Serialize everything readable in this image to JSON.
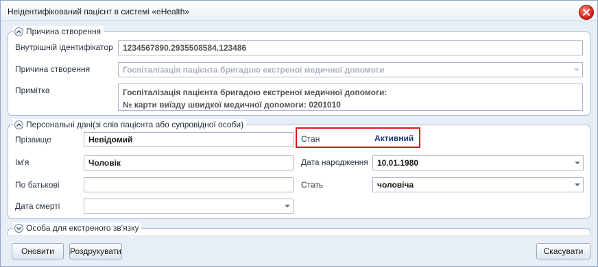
{
  "window": {
    "title": "Неідентифікований пацієнт в системі «eHealth»"
  },
  "creation_group": {
    "header": "Причина створення",
    "internal_id_label": "Внутрішній ідентифікатор",
    "internal_id_value": "1234567890.2935508584.123486",
    "reason_label": "Причина створення",
    "reason_value": "Госпіталізація пацієнта бригадою екстреної медичної допомоги",
    "note_label": "Примітка",
    "note_line1": "Госпіталізація пацієнта бригадою екстреної медичної допомоги:",
    "note_line2": "№ карти виїзду швидкої медичної допомоги: 0201010"
  },
  "personal_group": {
    "header": "Персональні дані(зі слів пацієнта або супровідної особи)",
    "surname_label": "Прізвище",
    "surname_value": "Невідомий",
    "name_label": "Ім'я",
    "name_value": "Чоловік",
    "patronymic_label": "По батькові",
    "patronymic_value": "",
    "death_date_label": "Дата смерті",
    "death_date_value": "",
    "status_label": "Стан",
    "status_value": "Активний",
    "birth_date_label": "Дата народження",
    "birth_date_value": "10.01.1980",
    "sex_label": "Стать",
    "sex_value": "чоловіча"
  },
  "emergency_group": {
    "header": "Особа для екстреного зв'язку"
  },
  "buttons": {
    "refresh": "Оновити",
    "print": "Роздрукувати",
    "cancel": "Скасувати"
  },
  "colors": {
    "status_highlight": "#e0141b",
    "status_text": "#1f3a78"
  }
}
